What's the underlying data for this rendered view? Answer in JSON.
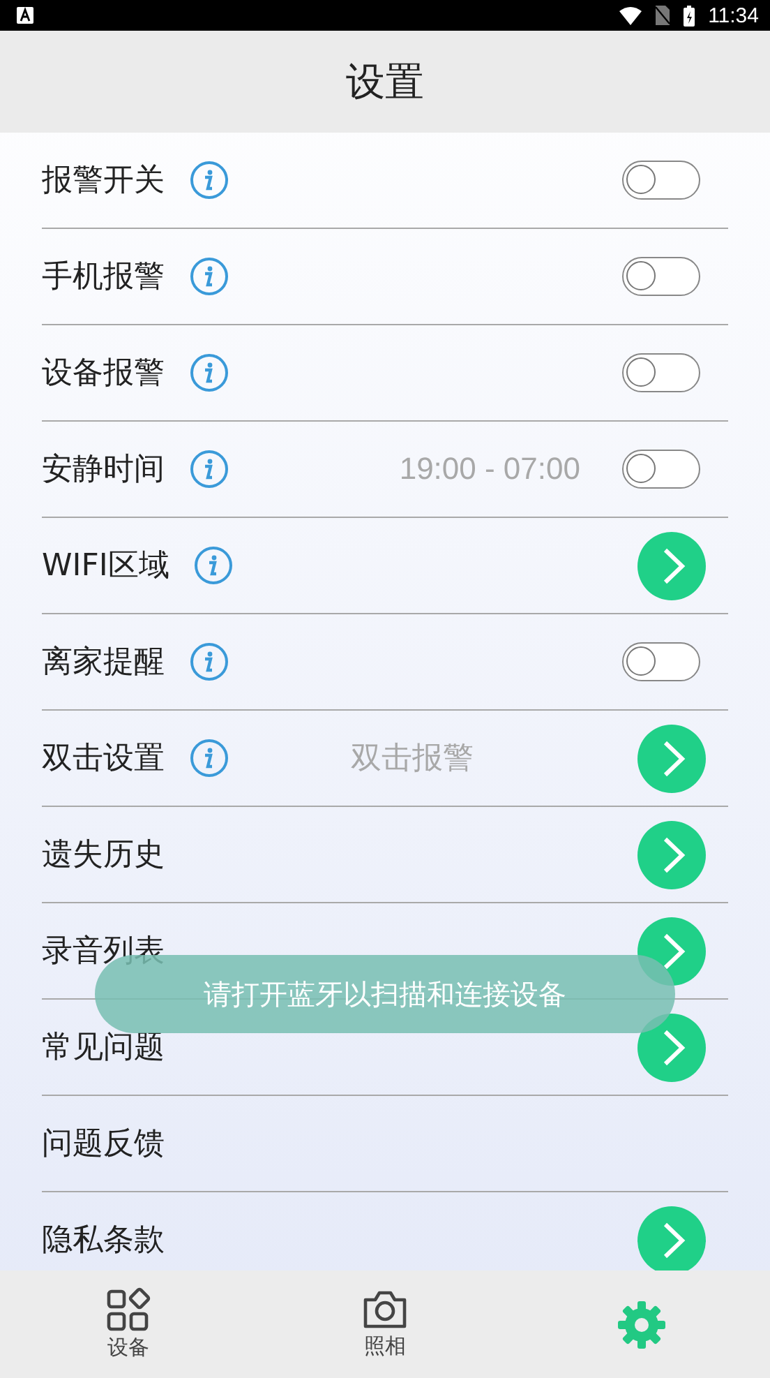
{
  "status_bar": {
    "time": "11:34"
  },
  "header": {
    "title": "设置"
  },
  "rows": [
    {
      "label": "报警开关",
      "info": true,
      "kind": "toggle",
      "on": false
    },
    {
      "label": "手机报警",
      "info": true,
      "kind": "toggle",
      "on": false
    },
    {
      "label": "设备报警",
      "info": true,
      "kind": "toggle",
      "on": false
    },
    {
      "label": "安静时间",
      "info": true,
      "kind": "toggle",
      "on": false,
      "value": "19:00 - 07:00"
    },
    {
      "label": "WIFI区域",
      "info": true,
      "kind": "arrow"
    },
    {
      "label": "离家提醒",
      "info": true,
      "kind": "toggle",
      "on": false
    },
    {
      "label": "双击设置",
      "info": true,
      "kind": "arrow",
      "value": "双击报警"
    },
    {
      "label": "遗失历史",
      "info": false,
      "kind": "arrow"
    },
    {
      "label": "录音列表",
      "info": false,
      "kind": "arrow"
    },
    {
      "label": "常见问题",
      "info": false,
      "kind": "arrow"
    },
    {
      "label": "问题反馈",
      "info": false,
      "kind": "plain"
    },
    {
      "label": "隐私条款",
      "info": false,
      "kind": "arrow"
    }
  ],
  "toast": {
    "text": "请打开蓝牙以扫描和连接设备"
  },
  "nav": [
    {
      "label": "设备",
      "selected": false
    },
    {
      "label": "照相",
      "selected": false
    },
    {
      "selected": true
    }
  ]
}
